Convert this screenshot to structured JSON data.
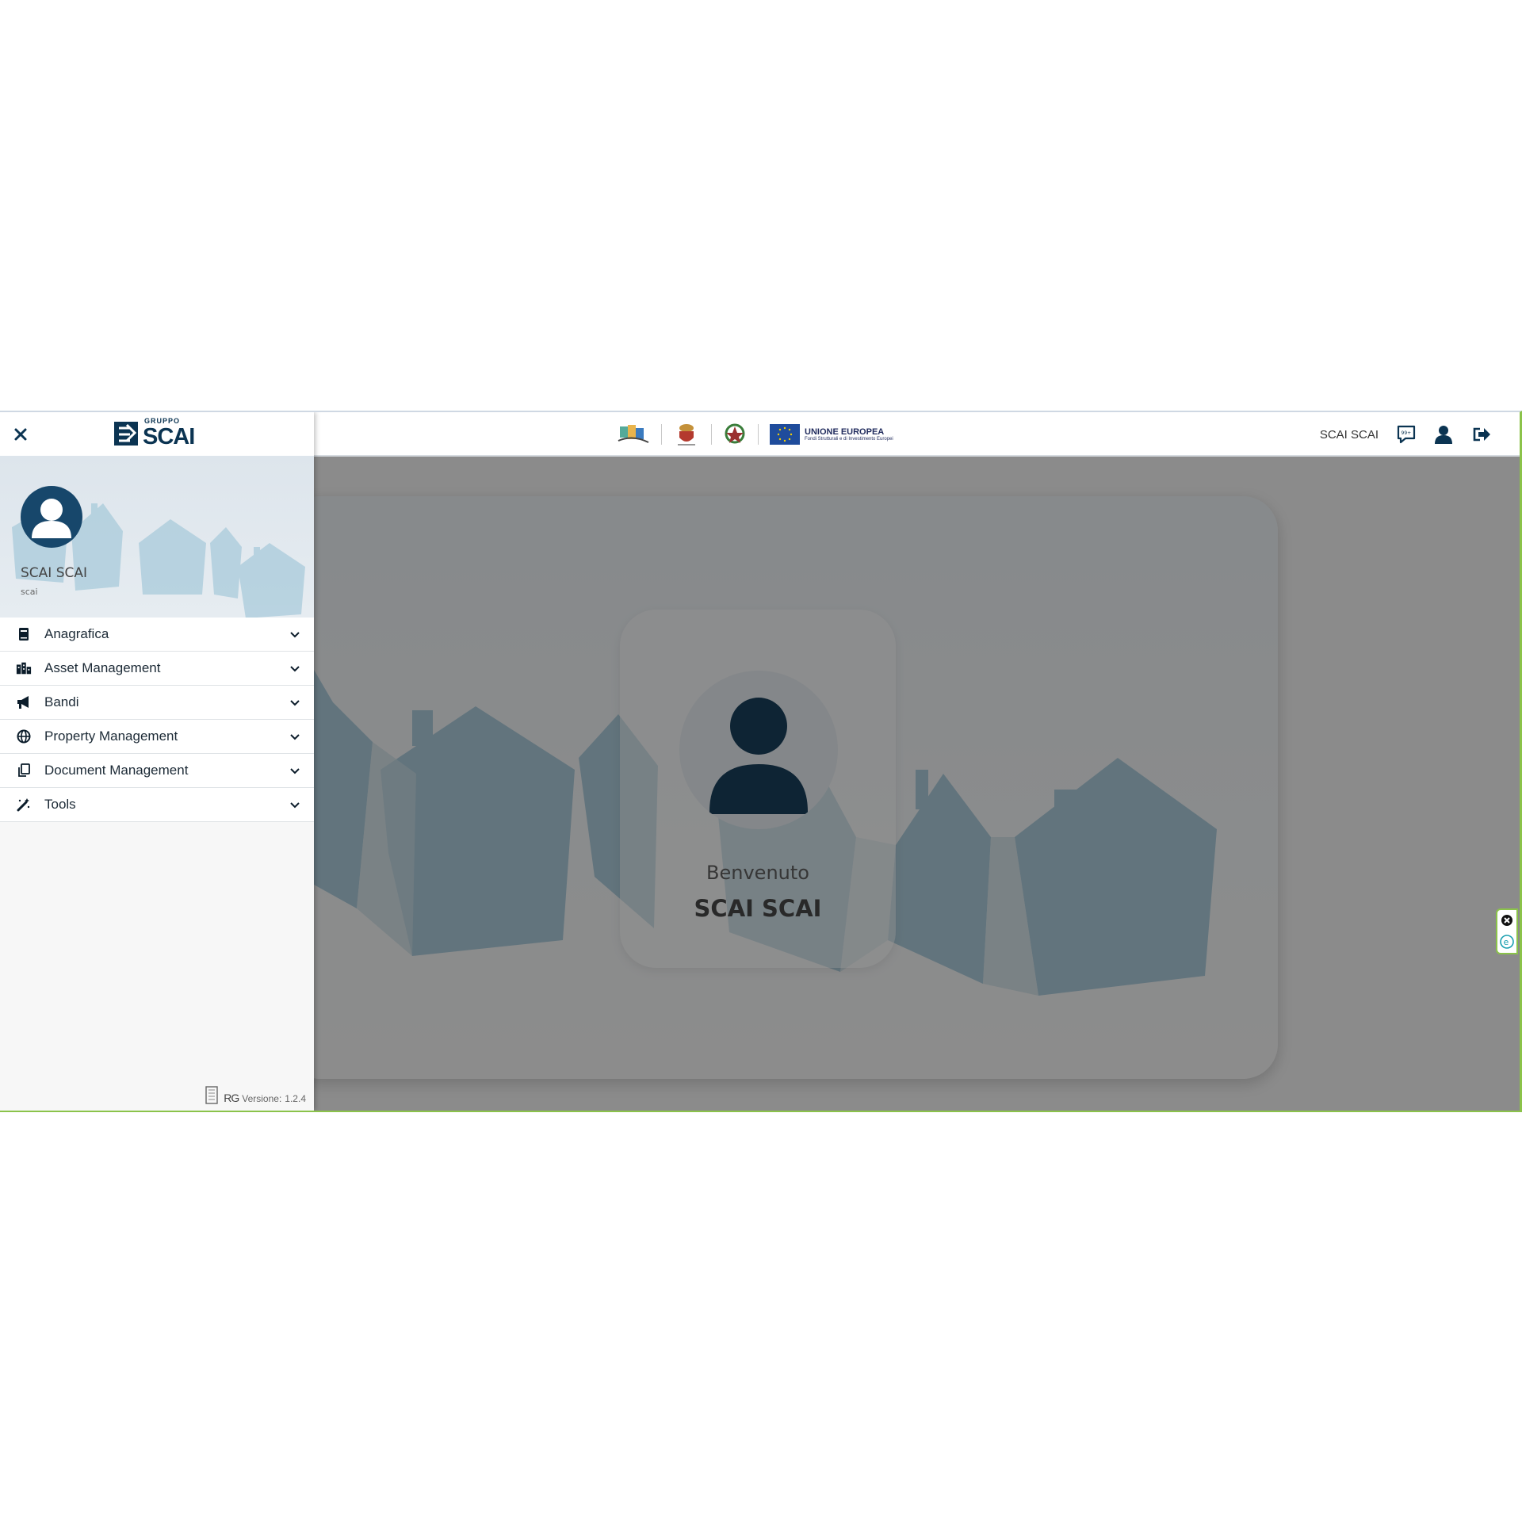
{
  "header": {
    "username": "SCAI SCAI",
    "eu_logo_title": "UNIONE EUROPEA",
    "eu_logo_subtitle": "Fondi Strutturali e di Investimento Europei",
    "icons": [
      "chat-icon",
      "user-icon",
      "logout-icon"
    ]
  },
  "sidebar": {
    "brand_top": "GRUPPO",
    "brand_name": "SCAI",
    "profile": {
      "name": "SCAI SCAI",
      "username": "scai"
    },
    "items": [
      {
        "label": "Anagrafica",
        "icon": "book-icon"
      },
      {
        "label": "Asset Management",
        "icon": "city-icon"
      },
      {
        "label": "Bandi",
        "icon": "megaphone-icon"
      },
      {
        "label": "Property Management",
        "icon": "globe-icon"
      },
      {
        "label": "Document Management",
        "icon": "copy-icon"
      },
      {
        "label": "Tools",
        "icon": "magic-wand-icon"
      }
    ],
    "footer": {
      "brand": "RG",
      "version_label": "Versione:",
      "version": "1.2.4"
    }
  },
  "main": {
    "welcome_label": "Benvenuto",
    "welcome_name": "SCAI SCAI"
  },
  "colors": {
    "primary": "#0b3452",
    "accent_border": "#8bc34a",
    "house_blue": "#a9cbdb"
  }
}
